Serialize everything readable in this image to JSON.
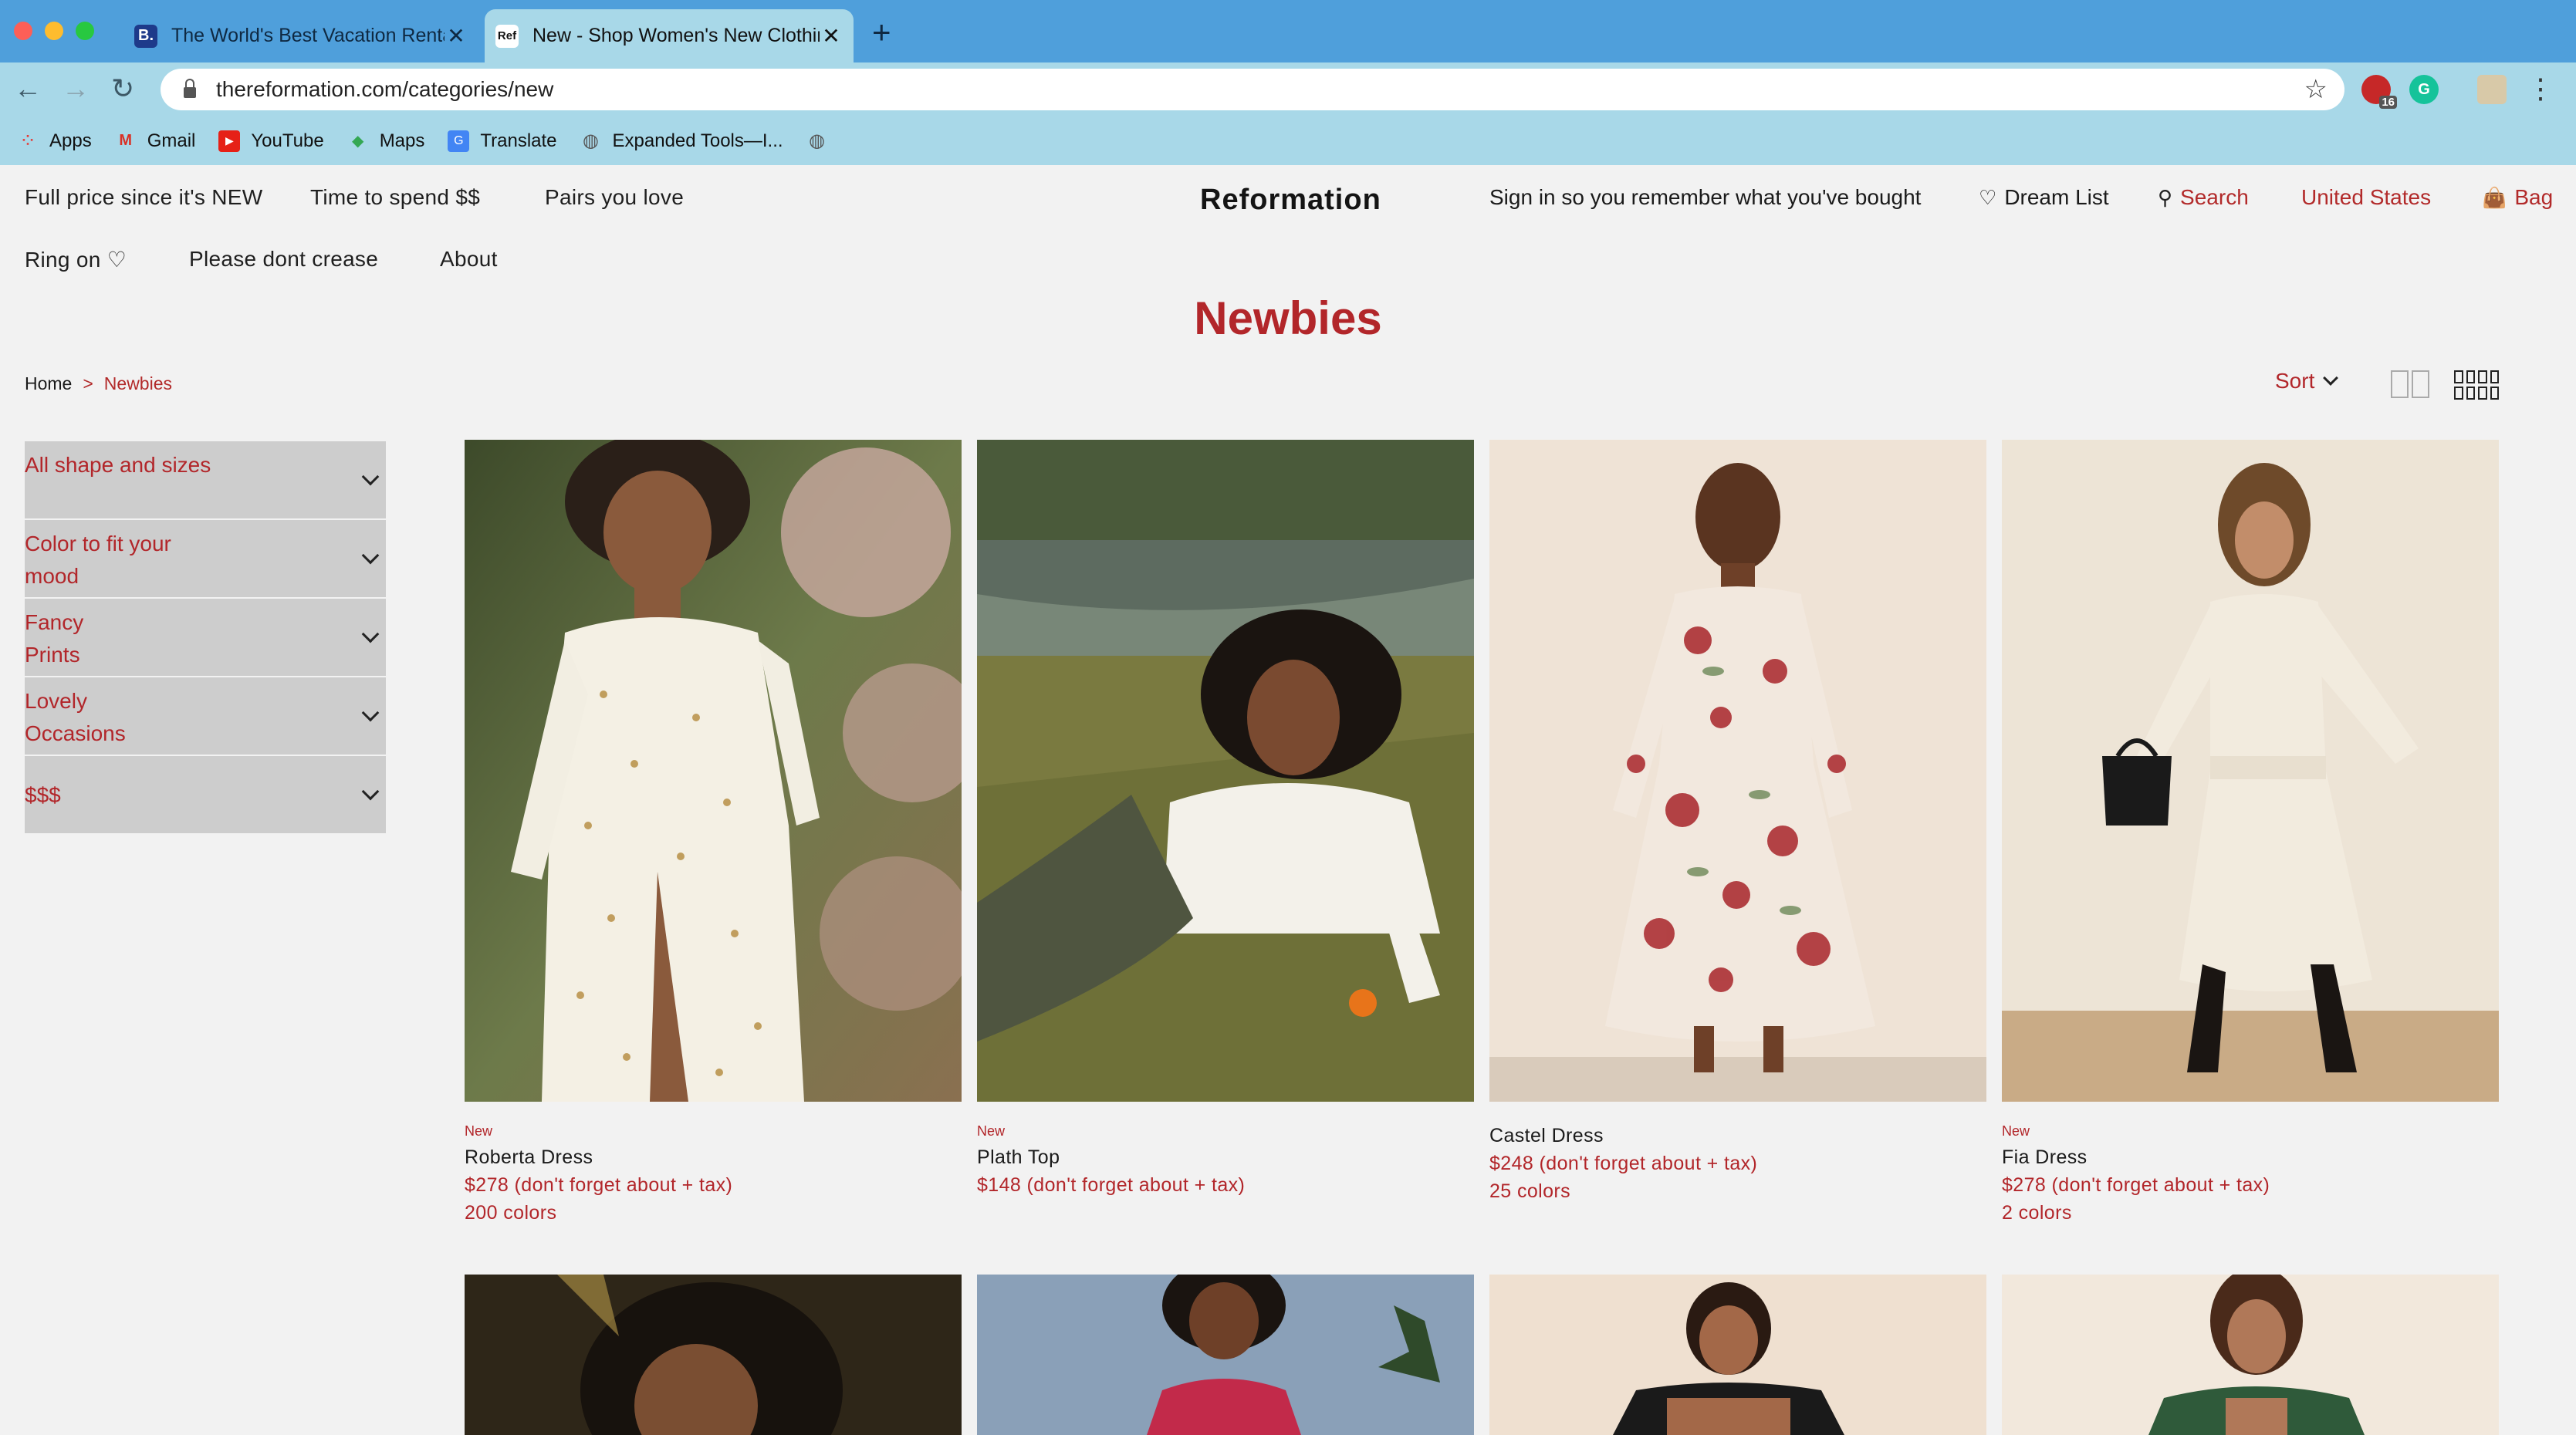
{
  "browser": {
    "tabs": [
      {
        "title": "The World's Best Vacation Rentals",
        "favicon": "B."
      },
      {
        "title": "New - Shop Women's New Clothing",
        "favicon": "Ref"
      }
    ],
    "url": "thereformation.com/categories/new",
    "extension_badge": "16",
    "bookmarks": [
      "Apps",
      "Gmail",
      "YouTube",
      "Maps",
      "Translate",
      "Expanded Tools—I..."
    ]
  },
  "nav": {
    "left_row1": [
      "Full price since it's NEW",
      "Time to spend $$",
      "Pairs you love"
    ],
    "left_row2": [
      "Ring on ♡",
      "Please dont crease",
      "About"
    ],
    "brand": "Reformation",
    "sign_in": "Sign in so you remember what you've bought",
    "dream_list": "Dream List",
    "search": "Search",
    "region": "United States",
    "bag": "Bag"
  },
  "page": {
    "title": "Newbies",
    "breadcrumb": {
      "home": "Home",
      "sep": ">",
      "current": "Newbies"
    },
    "sort_label": "Sort"
  },
  "filters": [
    {
      "label": "All shape and sizes"
    },
    {
      "label": "Color to fit your mood"
    },
    {
      "label": "Fancy Prints"
    },
    {
      "label": "Lovely Occasions"
    },
    {
      "label": "$$$"
    }
  ],
  "products": [
    {
      "tag": "New",
      "name": "Roberta Dress",
      "price": "$278 (don't forget about + tax)",
      "colors": "200 colors"
    },
    {
      "tag": "New",
      "name": "Plath Top",
      "price": "$148 (don't forget about + tax)",
      "colors": ""
    },
    {
      "tag": "",
      "name": "Castel Dress",
      "price": "$248 (don't forget about + tax)",
      "colors": "25 colors"
    },
    {
      "tag": "New",
      "name": "Fia Dress",
      "price": "$278 (don't forget about + tax)",
      "colors": "2 colors"
    }
  ],
  "colors": {
    "accent": "#b2262a",
    "filter_bg": "#cdcdcd",
    "tabbar": "#4f9fdb",
    "toolbar": "#a8d8e8"
  }
}
